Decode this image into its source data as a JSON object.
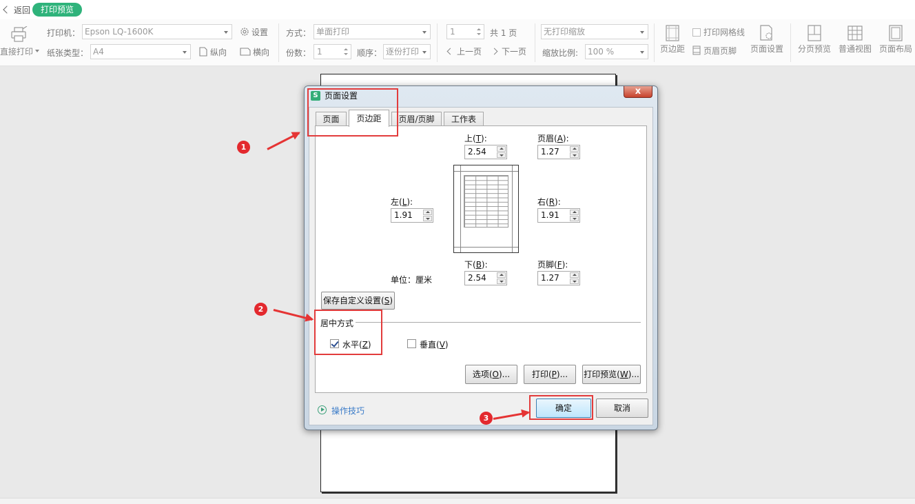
{
  "topbar": {
    "back_label": "返回",
    "mode_badge": "打印预览"
  },
  "ribbon": {
    "direct_print": "直接打印",
    "printer_label": "打印机：",
    "printer_value": "Epson LQ-1600K",
    "settings_label": "设置",
    "paper_type_label": "纸张类型：",
    "paper_type_value": "A4",
    "portrait_label": "纵向",
    "landscape_label": "横向",
    "mode_label": "方式：",
    "mode_value": "单面打印",
    "copies_label": "份数：",
    "copies_value": "1",
    "order_label": "顺序：",
    "order_value": "逐份打印",
    "page_value": "1",
    "total_pages": "共 1 页",
    "prev_page": "上一页",
    "next_page": "下一页",
    "scaling_value": "无打印缩放",
    "zoom_label": "缩放比例:",
    "zoom_value": "100 %",
    "print_gridlines": "打印网格线",
    "header_footer": "页眉页脚",
    "margins_btn": "页边距",
    "page_setup_btn": "页面设置",
    "page_break_preview": "分页预览",
    "normal_view": "普通视图",
    "page_layout": "页面布局"
  },
  "dialog": {
    "title": "页面设置",
    "close_label": "x",
    "tabs": [
      "页面",
      "页边距",
      "页眉/页脚",
      "工作表"
    ],
    "active_tab": "页边距",
    "fields": {
      "top_label": "上(",
      "top_key": "T",
      "top_value": "2.54",
      "header_label": "页眉(",
      "header_key": "A",
      "header_value": "1.27",
      "left_label": "左(",
      "left_key": "L",
      "left_value": "1.91",
      "right_label": "右(",
      "right_key": "R",
      "right_value": "1.91",
      "bottom_label": "下(",
      "bottom_key": "B",
      "bottom_value": "2.54",
      "footer_label": "页脚(",
      "footer_key": "F",
      "footer_value": "1.27",
      "colon_end": "):"
    },
    "unit_label": "单位：厘米",
    "save_custom": "保存自定义设置(",
    "save_custom_key": "S",
    "save_custom_end": ")",
    "centering_section": "居中方式",
    "horizontal": "水平(",
    "horizontal_key": "Z",
    "horizontal_checked": true,
    "vertical": "垂直(",
    "vertical_key": "V",
    "vertical_checked": false,
    "options_btn": "选项(",
    "options_key": "O",
    "options_end": ")...",
    "print_btn": "打印(",
    "print_key": "P",
    "print_end": ")...",
    "preview_btn": "打印预览(",
    "preview_key": "W",
    "preview_end": ")...",
    "tips": "操作技巧",
    "ok": "确定",
    "cancel": "取消",
    "paren_close": ")"
  },
  "annotations": {
    "step1": "1",
    "step2": "2",
    "step3": "3"
  },
  "colors": {
    "accent_green": "#2fb37b",
    "annotation_red": "#e3292e",
    "link_blue": "#3a7bc8"
  }
}
